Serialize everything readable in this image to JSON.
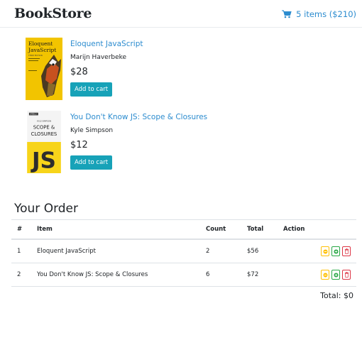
{
  "header": {
    "brand": "BookStore",
    "cart_summary": "5 items ($210)"
  },
  "books": [
    {
      "title": "Eloquent JavaScript",
      "author": "Marijn Haverbeke",
      "price": "$28",
      "button": "Add to cart",
      "cover": {
        "title_line1": "Eloquent",
        "title_line2": "JavaScript",
        "edition": "THIRD EDITION",
        "color": "#f2c400"
      }
    },
    {
      "title": "You Don't Know JS: Scope & Closures",
      "author": "Kyle Simpson",
      "price": "$12",
      "button": "Add to cart",
      "cover": {
        "publisher": "O'REILLY",
        "author_line": "KYLE SIMPSON",
        "title_line1": "SCOPE &",
        "title_line2": "CLOSURES",
        "logo": "JS",
        "color": "#f7d41a"
      }
    }
  ],
  "order": {
    "title": "Your Order",
    "columns": [
      "#",
      "Item",
      "Count",
      "Total",
      "Action"
    ],
    "rows": [
      {
        "num": "1",
        "item": "Eloquent JavaScript",
        "count": "2",
        "total": "$56"
      },
      {
        "num": "2",
        "item": "You Don't Know JS: Scope & Closures",
        "count": "6",
        "total": "$72"
      }
    ],
    "total": "Total: $0"
  },
  "colors": {
    "link": "#2c8ccf",
    "button": "#17a2b8",
    "minus": "#ffc107",
    "plus": "#28a745",
    "trash": "#dc3545"
  },
  "icons": [
    "cart-icon",
    "minus-circle-icon",
    "plus-circle-icon",
    "trash-icon"
  ]
}
